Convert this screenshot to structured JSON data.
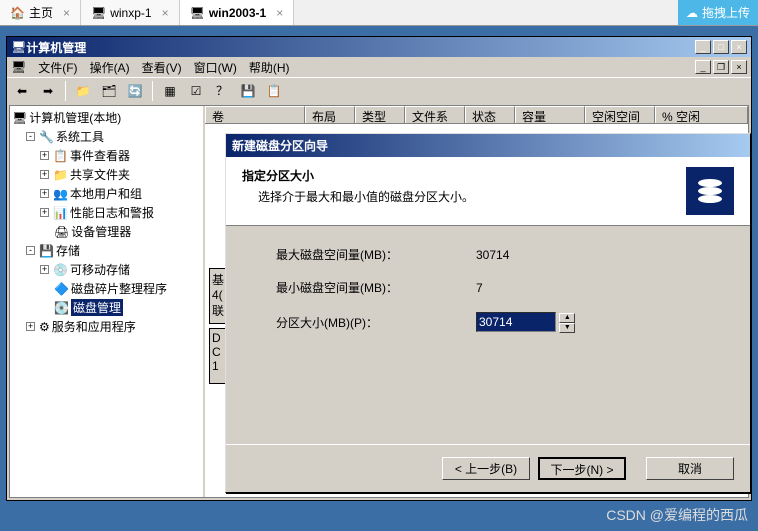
{
  "vm_tabs": {
    "home": "主页",
    "tab1": "winxp-1",
    "tab2": "win2003-1"
  },
  "upload": "拖拽上传",
  "mmc": {
    "title": "计算机管理",
    "menu": {
      "file": "文件(F)",
      "action": "操作(A)",
      "view": "查看(V)",
      "window": "窗口(W)",
      "help": "帮助(H)"
    }
  },
  "tree": {
    "root": "计算机管理(本地)",
    "system_tools": "系统工具",
    "event_viewer": "事件查看器",
    "shared_folders": "共享文件夹",
    "local_users": "本地用户和组",
    "perf_logs": "性能日志和警报",
    "device_mgr": "设备管理器",
    "storage": "存储",
    "removable": "可移动存储",
    "defrag": "磁盘碎片整理程序",
    "disk_mgmt": "磁盘管理",
    "services": "服务和应用程序"
  },
  "columns": {
    "volume": "卷",
    "layout": "布局",
    "type": "类型",
    "filesystem": "文件系统",
    "status": "状态",
    "capacity": "容量",
    "free": "空闲空间",
    "pct_free": "% 空闲"
  },
  "disk_labels": {
    "basic": "基",
    "size": "4(",
    "online": "联"
  },
  "dialog": {
    "title": "新建磁盘分区向导",
    "heading": "指定分区大小",
    "subtext": "选择介于最大和最小值的磁盘分区大小。",
    "max_label": "最大磁盘空间量(MB)：",
    "max_value": "30714",
    "min_label": "最小磁盘空间量(MB)：",
    "min_value": "7",
    "size_label": "分区大小(MB)(P)：",
    "size_value": "30714",
    "back": "< 上一步(B)",
    "next": "下一步(N) >",
    "cancel": "取消"
  },
  "watermark": "CSDN @爱编程的西瓜"
}
